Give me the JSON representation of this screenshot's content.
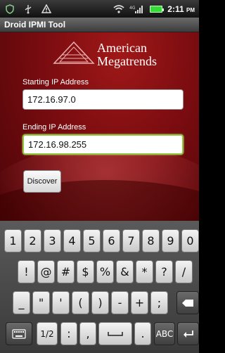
{
  "status_bar": {
    "network_type": "4G",
    "time": "2:11",
    "ampm": "PM"
  },
  "app": {
    "title": "Droid IPMI Tool",
    "logo_line1": "American",
    "logo_line2": "Megatrends",
    "start_label": "Starting IP Address",
    "start_value": "172.16.97.0",
    "end_label": "Ending IP Address",
    "end_value": "172.16.98.255",
    "discover_label": "Discover"
  },
  "keyboard": {
    "row1": [
      "1",
      "2",
      "3",
      "4",
      "5",
      "6",
      "7",
      "8",
      "9",
      "0"
    ],
    "row2": [
      "!",
      "@",
      "#",
      "$",
      "%",
      "&",
      "*",
      "?",
      "/"
    ],
    "row3": [
      "_",
      "\"",
      "'",
      "(",
      ")",
      "-",
      "+",
      ";"
    ],
    "shift_label": "1/2",
    "colon": ":",
    "comma": ",",
    "dot": ".",
    "abc_label": "ABC"
  },
  "colors": {
    "accent": "#8fc73e",
    "brand_red": "#a01818"
  }
}
